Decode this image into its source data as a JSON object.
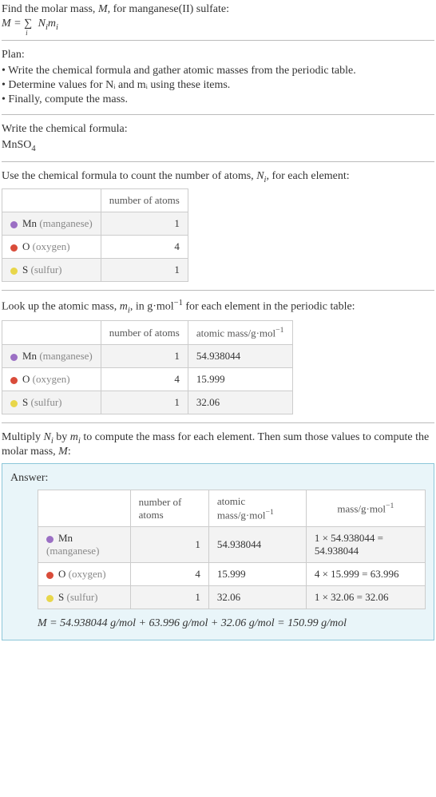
{
  "intro": {
    "line1_a": "Find the molar mass, ",
    "line1_b": "M",
    "line1_c": ", for manganese(II) sulfate:",
    "formula_lhs": "M = ",
    "formula_sigma": "∑",
    "formula_sub": "i",
    "formula_rhs_a": " N",
    "formula_rhs_b": "i",
    "formula_rhs_c": "m",
    "formula_rhs_d": "i"
  },
  "plan": {
    "heading": "Plan:",
    "items": [
      "• Write the chemical formula and gather atomic masses from the periodic table.",
      "• Determine values for Nᵢ and mᵢ using these items.",
      "• Finally, compute the mass."
    ]
  },
  "chem": {
    "heading": "Write the chemical formula:",
    "formula_a": "MnSO",
    "formula_sub": "4"
  },
  "count": {
    "heading_a": "Use the chemical formula to count the number of atoms, ",
    "heading_b": "N",
    "heading_c": "i",
    "heading_d": ", for each element:",
    "headers": {
      "col1": "",
      "col2": "number of atoms"
    },
    "rows": [
      {
        "elem": "Mn",
        "name": "(manganese)",
        "n": "1",
        "dot": "purple"
      },
      {
        "elem": "O",
        "name": "(oxygen)",
        "n": "4",
        "dot": "red"
      },
      {
        "elem": "S",
        "name": "(sulfur)",
        "n": "1",
        "dot": "yellow"
      }
    ]
  },
  "masses": {
    "heading_a": "Look up the atomic mass, ",
    "heading_b": "m",
    "heading_c": "i",
    "heading_d": ", in g·mol",
    "heading_e": "−1",
    "heading_f": " for each element in the periodic table:",
    "headers": {
      "col1": "",
      "col2": "number of atoms",
      "col3_a": "atomic mass/g·mol",
      "col3_b": "−1"
    },
    "rows": [
      {
        "elem": "Mn",
        "name": "(manganese)",
        "n": "1",
        "m": "54.938044",
        "dot": "purple"
      },
      {
        "elem": "O",
        "name": "(oxygen)",
        "n": "4",
        "m": "15.999",
        "dot": "red"
      },
      {
        "elem": "S",
        "name": "(sulfur)",
        "n": "1",
        "m": "32.06",
        "dot": "yellow"
      }
    ]
  },
  "compute": {
    "line_a": "Multiply ",
    "line_b": "N",
    "line_c": "i",
    "line_d": " by ",
    "line_e": "m",
    "line_f": "i",
    "line_g": " to compute the mass for each element. Then sum those values to compute the molar mass, ",
    "line_h": "M",
    "line_i": ":"
  },
  "answer": {
    "label": "Answer:",
    "headers": {
      "col1": "",
      "col2": "number of atoms",
      "col3_a": "atomic mass/g·mol",
      "col3_b": "−1",
      "col4_a": "mass/g·mol",
      "col4_b": "−1"
    },
    "rows": [
      {
        "elem": "Mn",
        "name": "(manganese)",
        "n": "1",
        "m": "54.938044",
        "calc": "1 × 54.938044 = 54.938044",
        "dot": "purple"
      },
      {
        "elem": "O",
        "name": "(oxygen)",
        "n": "4",
        "m": "15.999",
        "calc": "4 × 15.999 = 63.996",
        "dot": "red"
      },
      {
        "elem": "S",
        "name": "(sulfur)",
        "n": "1",
        "m": "32.06",
        "calc": "1 × 32.06 = 32.06",
        "dot": "yellow"
      }
    ],
    "sum": "M = 54.938044 g/mol + 63.996 g/mol + 32.06 g/mol = 150.99 g/mol"
  }
}
